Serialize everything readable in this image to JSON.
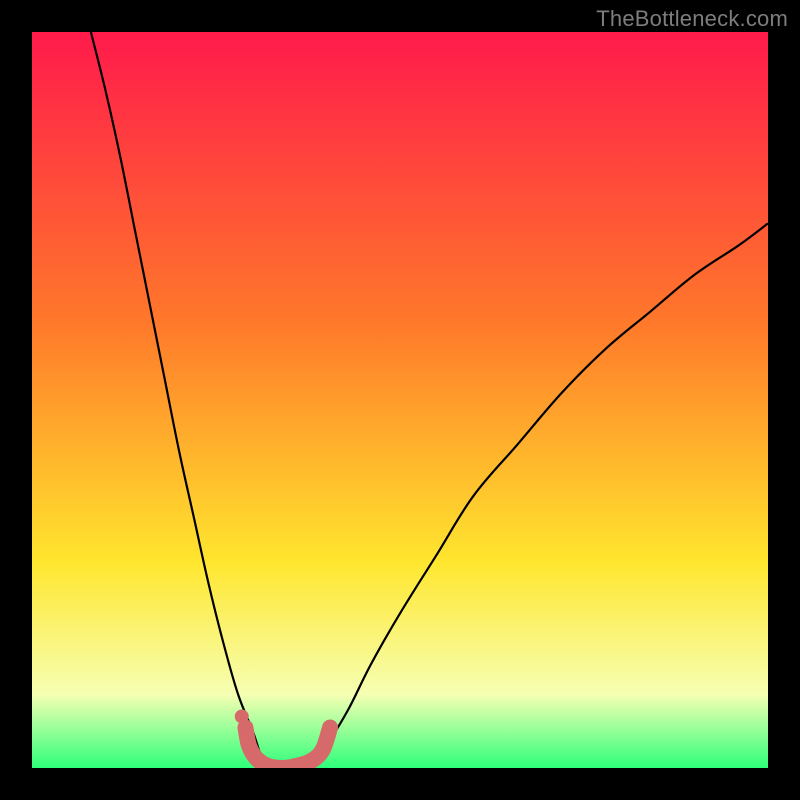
{
  "watermark": "TheBottleneck.com",
  "chart_data": {
    "type": "line",
    "title": "",
    "xlabel": "",
    "ylabel": "",
    "xlim": [
      0,
      100
    ],
    "ylim": [
      0,
      100
    ],
    "background_gradient": {
      "top": "#ff1a4b",
      "mid1": "#ff7a2a",
      "mid2": "#ffe62e",
      "bottom": "#2eff7a"
    },
    "series": [
      {
        "name": "left-curve",
        "x": [
          8,
          10,
          12,
          14,
          16,
          18,
          20,
          22,
          24,
          26,
          28,
          30,
          31,
          32
        ],
        "y": [
          100,
          92,
          83,
          73,
          63,
          53,
          43,
          34,
          25,
          17,
          10,
          5,
          2,
          0
        ]
      },
      {
        "name": "right-curve",
        "x": [
          38,
          40,
          43,
          46,
          50,
          55,
          60,
          66,
          72,
          78,
          84,
          90,
          96,
          100
        ],
        "y": [
          0,
          3,
          8,
          14,
          21,
          29,
          37,
          44,
          51,
          57,
          62,
          67,
          71,
          74
        ]
      }
    ],
    "highlight_band": {
      "name": "bottom-pink-segment",
      "x": [
        29.0,
        29.5,
        30.5,
        32.0,
        34.0,
        36.0,
        38.0,
        39.5,
        40.5
      ],
      "y": [
        5.5,
        3.0,
        1.3,
        0.3,
        0.0,
        0.3,
        1.0,
        2.5,
        5.5
      ]
    },
    "highlight_dot": {
      "x": 28.5,
      "y": 7.0
    }
  }
}
